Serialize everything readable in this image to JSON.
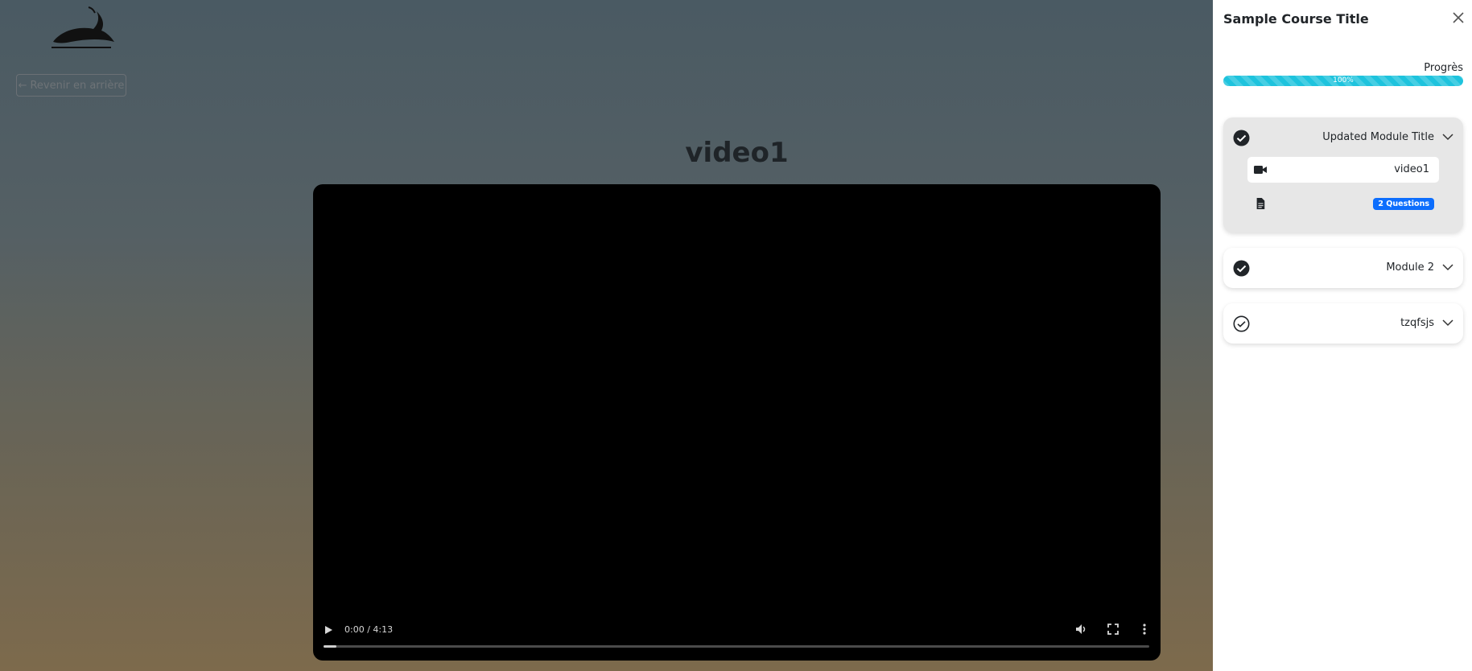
{
  "header": {
    "back_label": "Revenir en arrière",
    "back_arrow": "←",
    "logo_icon": "gazelle-logo-icon"
  },
  "video": {
    "title": "video1",
    "time": "0:00 / 4:13",
    "progress": 0.016
  },
  "sidebar": {
    "course_title": "Sample Course Title",
    "progress_label": "Progrès",
    "progress_value": "100%",
    "progress_color": "#1ec3dd",
    "modules": [
      {
        "title": "Updated Module Title",
        "completed": true,
        "expanded": true,
        "lessons": [
          {
            "type": "video-icon",
            "label": "video1"
          },
          {
            "type": "document-icon",
            "badge": "2 Questions"
          }
        ]
      },
      {
        "title": "Module 2",
        "completed": true,
        "expanded": false
      },
      {
        "title": "tzqfsjs",
        "completed": false,
        "expanded": false
      }
    ],
    "badge_color": "#0d6efd"
  }
}
